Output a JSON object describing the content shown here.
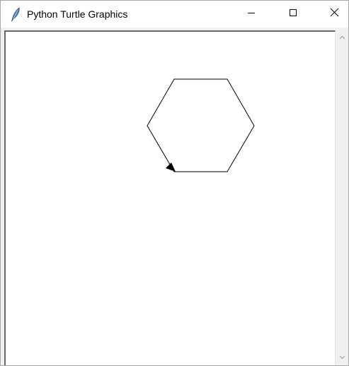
{
  "window": {
    "title": "Python Turtle Graphics",
    "app_icon": "feather-icon"
  },
  "controls": {
    "minimize_icon": "minimize-icon",
    "maximize_icon": "maximize-icon",
    "close_icon": "close-icon"
  },
  "canvas": {
    "background": "#ffffff",
    "shape": "hexagon",
    "pen_color": "#000000",
    "turtle_shape": "arrow",
    "turtle_heading": "southeast"
  },
  "scrollbar": {
    "up_icon": "scroll-up-arrow-icon",
    "down_icon": "scroll-down-arrow-icon"
  }
}
